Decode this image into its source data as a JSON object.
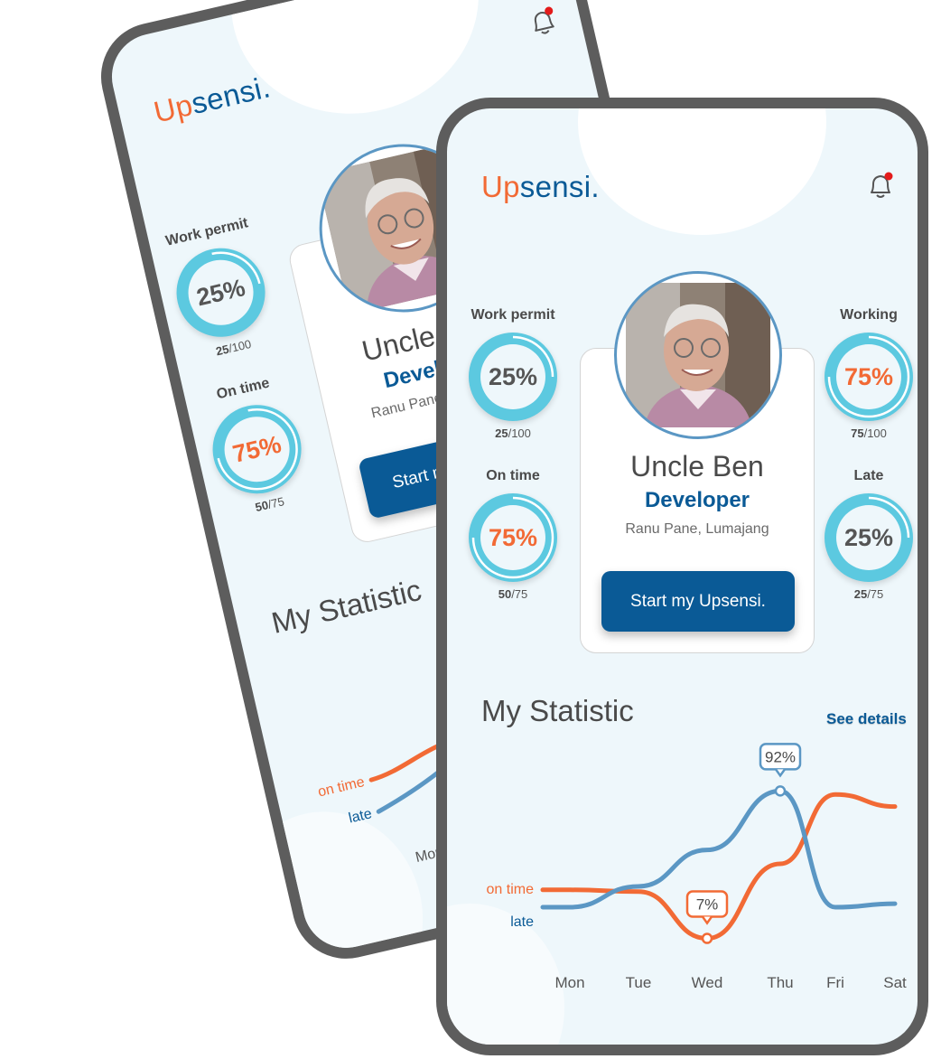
{
  "brand": {
    "prefix": "Up",
    "suffix": "sensi."
  },
  "notification": {
    "icon": "bell-icon",
    "has_unread": true,
    "dot_color": "#e31b1b"
  },
  "colors": {
    "primary": "#0a5a96",
    "accent": "#f26a35",
    "ring": "#5cc9e0",
    "late_line": "#5b97c4"
  },
  "profile": {
    "name": "Uncle Ben",
    "role": "Developer",
    "location": "Ranu Pane, Lumajang",
    "cta_label": "Start my Upsensi."
  },
  "stats": {
    "work_permit": {
      "title": "Work permit",
      "percent": "25%",
      "count": "25",
      "total": "/100",
      "fraction": 0.25
    },
    "on_time": {
      "title": "On time",
      "percent": "75%",
      "count": "50",
      "total": "/75",
      "fraction": 0.75
    },
    "working": {
      "title": "Working",
      "percent": "75%",
      "count": "75",
      "total": "/100",
      "fraction": 0.75
    },
    "late": {
      "title": "Late",
      "percent": "25%",
      "count": "25",
      "total": "/75",
      "fraction": 0.25
    }
  },
  "statistic": {
    "title": "My Statistic",
    "see_details": "See details"
  },
  "chart_data": {
    "type": "line",
    "categories": [
      "Mon",
      "Tue",
      "Wed",
      "Thu",
      "Fri",
      "Sat"
    ],
    "series": [
      {
        "name": "on time",
        "color": "#f26a35",
        "values": [
          35,
          34,
          7,
          50,
          90,
          83
        ]
      },
      {
        "name": "late",
        "color": "#5b97c4",
        "values": [
          25,
          37,
          58,
          92,
          25,
          27
        ]
      }
    ],
    "annotations": [
      {
        "category": "Wed",
        "series": "on time",
        "label": "7%"
      },
      {
        "category": "Thu",
        "series": "late",
        "label": "92%"
      }
    ],
    "legend": "left"
  }
}
